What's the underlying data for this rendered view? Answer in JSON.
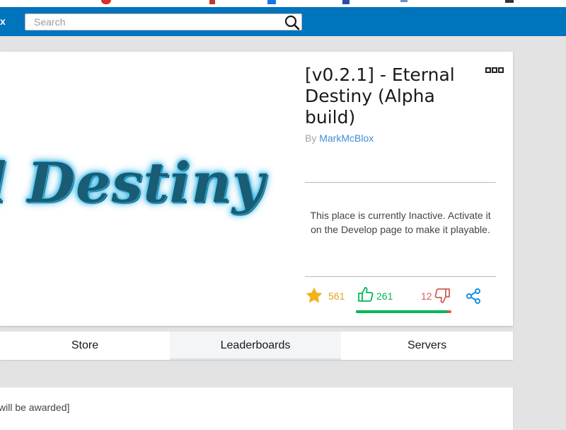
{
  "header": {
    "logo_tail": "x",
    "search": {
      "placeholder": "Search",
      "value": ""
    }
  },
  "game": {
    "title": "[v0.2.1] - Eternal Destiny (Alpha build)",
    "thumbnail_text": "al Destiny",
    "by_label": "By",
    "creator": "MarkMcBlox",
    "inactive_message": "This place is currently Inactive. Activate it on the Develop page to make it playable.",
    "favorites": "561",
    "likes": "261",
    "dislikes": "12",
    "like_ratio": 0.956
  },
  "tabs": [
    {
      "label": "Store",
      "active": false
    },
    {
      "label": "Leaderboards",
      "active": true
    },
    {
      "label": "Servers",
      "active": false
    }
  ],
  "description": {
    "text": "will be awarded]"
  },
  "colors": {
    "topbar": "#0074bd",
    "link": "#3a8fd6",
    "favorite": "#e2a516",
    "like": "#02b757",
    "dislike": "#d65a5a"
  }
}
